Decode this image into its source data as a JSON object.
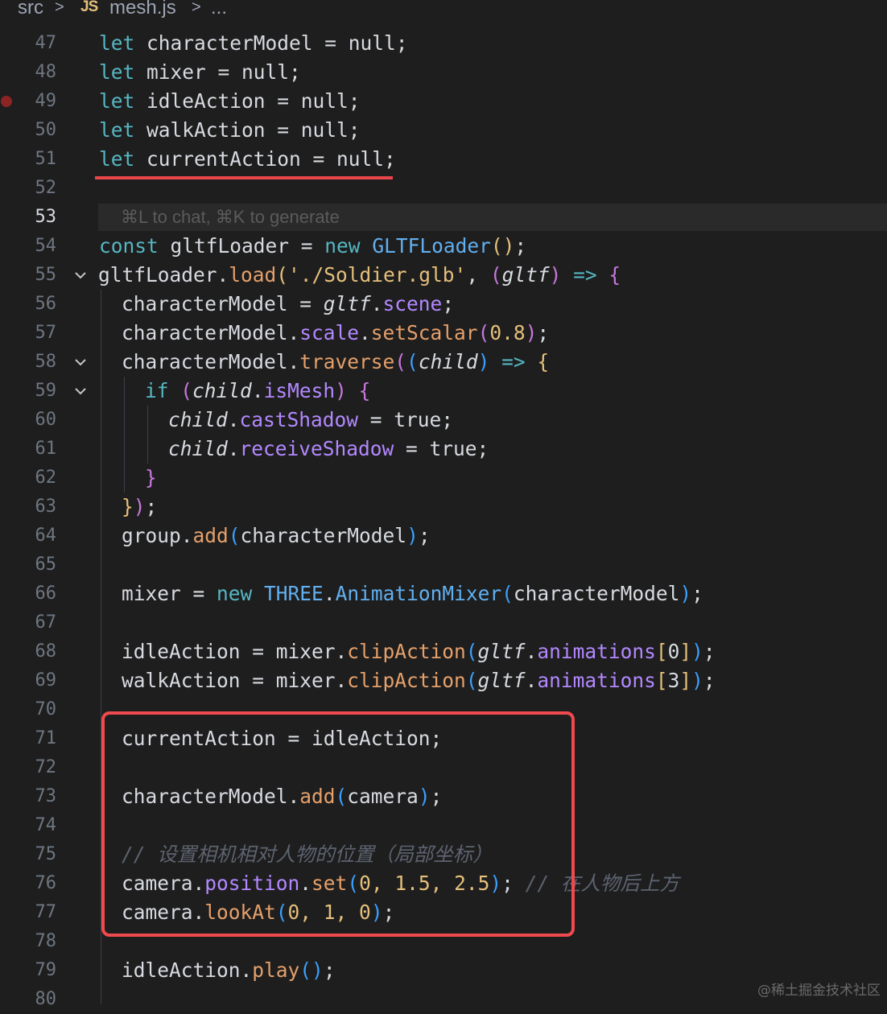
{
  "breadcrumb": {
    "folder": "src",
    "sep": ">",
    "file_icon": "JS",
    "file": "mesh.js",
    "ellipsis": "..."
  },
  "editor": {
    "active_line": 53,
    "inline_hint": "⌘L to chat, ⌘K to generate",
    "breakpoint_line": 49,
    "line_numbers": [
      "47",
      "48",
      "49",
      "50",
      "51",
      "52",
      "53",
      "54",
      "55",
      "56",
      "57",
      "58",
      "59",
      "60",
      "61",
      "62",
      "63",
      "64",
      "65",
      "66",
      "67",
      "68",
      "69",
      "70",
      "71",
      "72",
      "73",
      "74",
      "75",
      "76",
      "77",
      "78",
      "79",
      "80"
    ],
    "folded_lines": [
      "55",
      "58",
      "59"
    ],
    "lines": {
      "l47": [
        "let",
        " characterModel = null;"
      ],
      "l48": [
        "let",
        " mixer = null;"
      ],
      "l49": [
        "let",
        " idleAction = null;"
      ],
      "l50": [
        "let",
        " walkAction = null;"
      ],
      "l51": [
        "let",
        " currentAction = null;"
      ],
      "l54": [
        "const",
        " gltfLoader = ",
        "new",
        " ",
        "GLTFLoader",
        "(",
        ")",
        ";"
      ],
      "l55": [
        "gltfLoader.",
        "load",
        "(",
        "'./Soldier.glb'",
        ", ",
        "(",
        "gltf",
        ")",
        " ",
        "=>",
        " ",
        "{"
      ],
      "l56": [
        "characterModel = ",
        "gltf",
        ".",
        "scene",
        ";"
      ],
      "l57": [
        "characterModel.",
        "scale",
        ".",
        "setScalar",
        "(",
        "0.8",
        ")",
        ";"
      ],
      "l58": [
        "characterModel.",
        "traverse",
        "(",
        "(",
        "child",
        ")",
        " ",
        "=>",
        " ",
        "{"
      ],
      "l59": [
        "if",
        " ",
        "(",
        "child",
        ".",
        "isMesh",
        ")",
        " ",
        "{"
      ],
      "l60": [
        "child",
        ".",
        "castShadow",
        " = true;"
      ],
      "l61": [
        "child",
        ".",
        "receiveShadow",
        " = true;"
      ],
      "l62": [
        "}"
      ],
      "l63": [
        "}",
        ")",
        ";"
      ],
      "l64": [
        "group.",
        "add",
        "(",
        "characterModel",
        ")",
        ";"
      ],
      "l66": [
        "mixer = ",
        "new",
        " ",
        "THREE",
        ".",
        "AnimationMixer",
        "(",
        "characterModel",
        ")",
        ";"
      ],
      "l68": [
        "idleAction = mixer.",
        "clipAction",
        "(",
        "gltf",
        ".",
        "animations",
        "[",
        "0",
        "]",
        ")",
        ";"
      ],
      "l69": [
        "walkAction = mixer.",
        "clipAction",
        "(",
        "gltf",
        ".",
        "animations",
        "[",
        "3",
        "]",
        ")",
        ";"
      ],
      "l71": [
        "currentAction = idleAction;"
      ],
      "l73": [
        "characterModel.",
        "add",
        "(",
        "camera",
        ")",
        ";"
      ],
      "l75": [
        "// 设置相机相对人物的位置（局部坐标）"
      ],
      "l76": [
        "camera.",
        "position",
        ".",
        "set",
        "(",
        "0, 1.5, 2.5",
        ")",
        ";",
        " // 在人物后上方"
      ],
      "l77": [
        "camera.",
        "lookAt",
        "(",
        "0, 1, 0",
        ")",
        ";"
      ],
      "l79": [
        "idleAction.",
        "play",
        "(",
        ")",
        ";"
      ]
    }
  },
  "annotations": {
    "underline_color": "#e8464c",
    "box_color": "#ef4a4e"
  },
  "watermark": "@稀土掘金技术社区"
}
